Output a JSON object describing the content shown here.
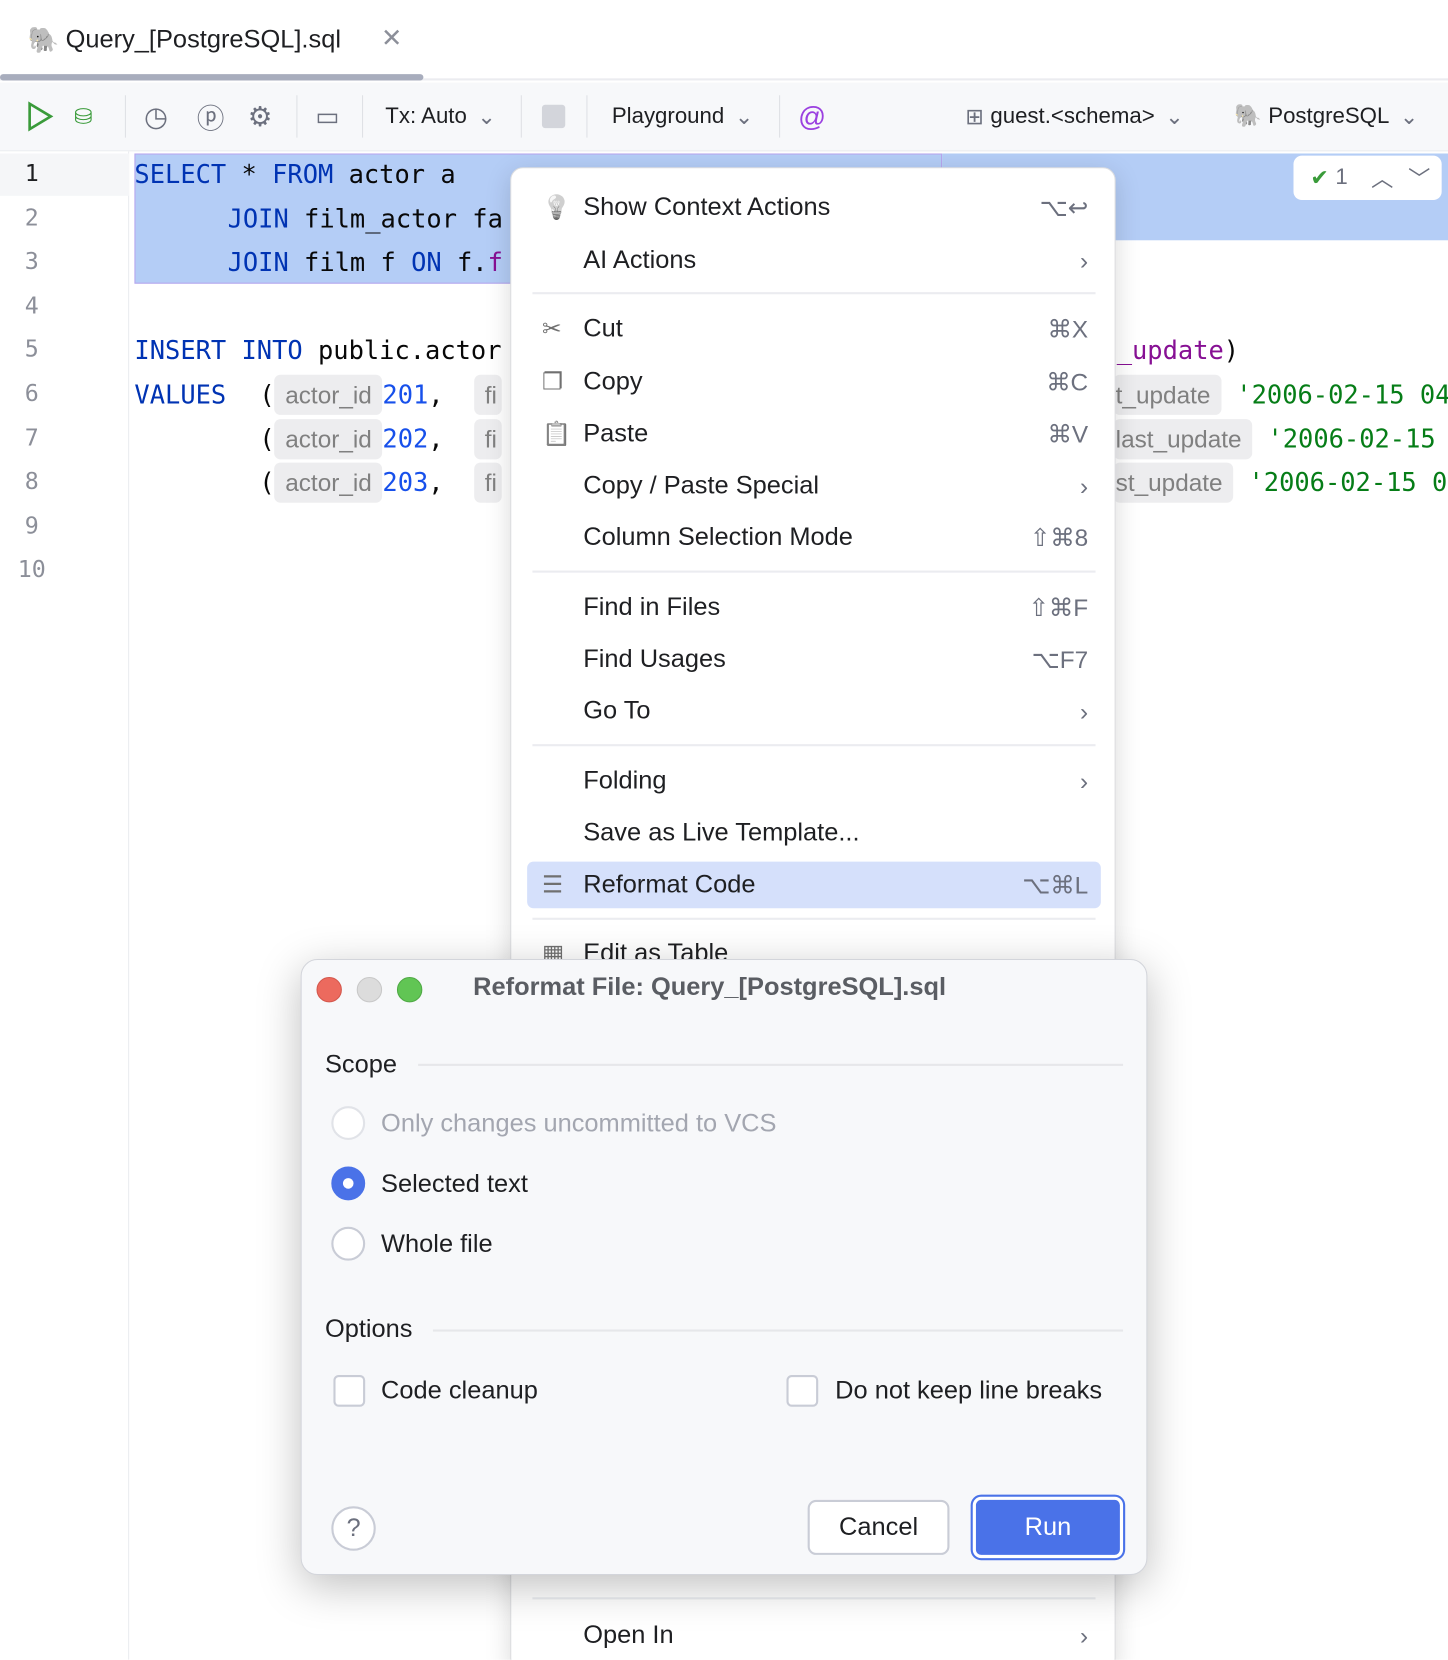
{
  "tab": {
    "title": "Query_[PostgreSQL].sql",
    "icon": "postgresql-elephant-icon"
  },
  "toolbar": {
    "tx": "Tx: Auto",
    "playground": "Playground",
    "schema": "guest.<schema>",
    "datasource": "PostgreSQL"
  },
  "editor": {
    "line_numbers": [
      "1",
      "2",
      "3",
      "4",
      "5",
      "6",
      "7",
      "8",
      "9",
      "10"
    ],
    "inspection_count": "1",
    "lines": {
      "l1": [
        "SELECT",
        " * ",
        "FROM",
        " actor a"
      ],
      "l2": [
        "JOIN",
        " film_actor fa"
      ],
      "l3": [
        "JOIN",
        " film f ",
        "ON",
        " f.",
        "f"
      ],
      "l5": [
        "INSERT INTO",
        " public.actor"
      ],
      "l5_right": [
        "_update",
        ")"
      ],
      "values_kw": "VALUES",
      "hint_actor_id": "actor_id",
      "ids": [
        "201",
        "202",
        "203"
      ],
      "hint_fi": "fi",
      "right_hints": [
        "t_update",
        "last_update",
        "st_update"
      ],
      "right_strs": [
        "'2006-02-15 04",
        "'2006-02-15",
        "'2006-02-15 0"
      ]
    }
  },
  "context_menu": {
    "items": [
      {
        "label": "Show Context Actions",
        "shortcut": "⌥↩",
        "icon": "lightbulb-icon"
      },
      {
        "label": "AI Actions",
        "submenu": true
      },
      {
        "label": "Cut",
        "shortcut": "⌘X",
        "icon": "scissors-icon"
      },
      {
        "label": "Copy",
        "shortcut": "⌘C",
        "icon": "copy-icon"
      },
      {
        "label": "Paste",
        "shortcut": "⌘V",
        "icon": "clipboard-icon"
      },
      {
        "label": "Copy / Paste Special",
        "submenu": true
      },
      {
        "label": "Column Selection Mode",
        "shortcut": "⇧⌘8"
      },
      {
        "label": "Find in Files",
        "shortcut": "⇧⌘F"
      },
      {
        "label": "Find Usages",
        "shortcut": "⌥F7"
      },
      {
        "label": "Go To",
        "submenu": true
      },
      {
        "label": "Folding",
        "submenu": true
      },
      {
        "label": "Save as Live Template..."
      },
      {
        "label": "Reformat Code",
        "shortcut": "⌥⌘L",
        "icon": "reformat-icon",
        "highlighted": true
      },
      {
        "label": "Edit as Table",
        "icon": "table-icon"
      },
      {
        "label": "Open In",
        "submenu": true
      }
    ]
  },
  "dialog": {
    "title": "Reformat File: Query_[PostgreSQL].sql",
    "scope_label": "Scope",
    "scope_options": [
      {
        "label": "Only changes uncommitted to VCS",
        "disabled": true,
        "selected": false
      },
      {
        "label": "Selected text",
        "selected": true
      },
      {
        "label": "Whole file",
        "selected": false
      }
    ],
    "options_label": "Options",
    "options": [
      {
        "label": "Code cleanup",
        "checked": false
      },
      {
        "label": "Do not keep line breaks",
        "checked": false
      }
    ],
    "cancel": "Cancel",
    "run": "Run",
    "help": "?"
  },
  "colors": {
    "accent": "#4a72e8",
    "selection": "#b4cdf6",
    "menu_highlight": "#d5e0fb"
  }
}
